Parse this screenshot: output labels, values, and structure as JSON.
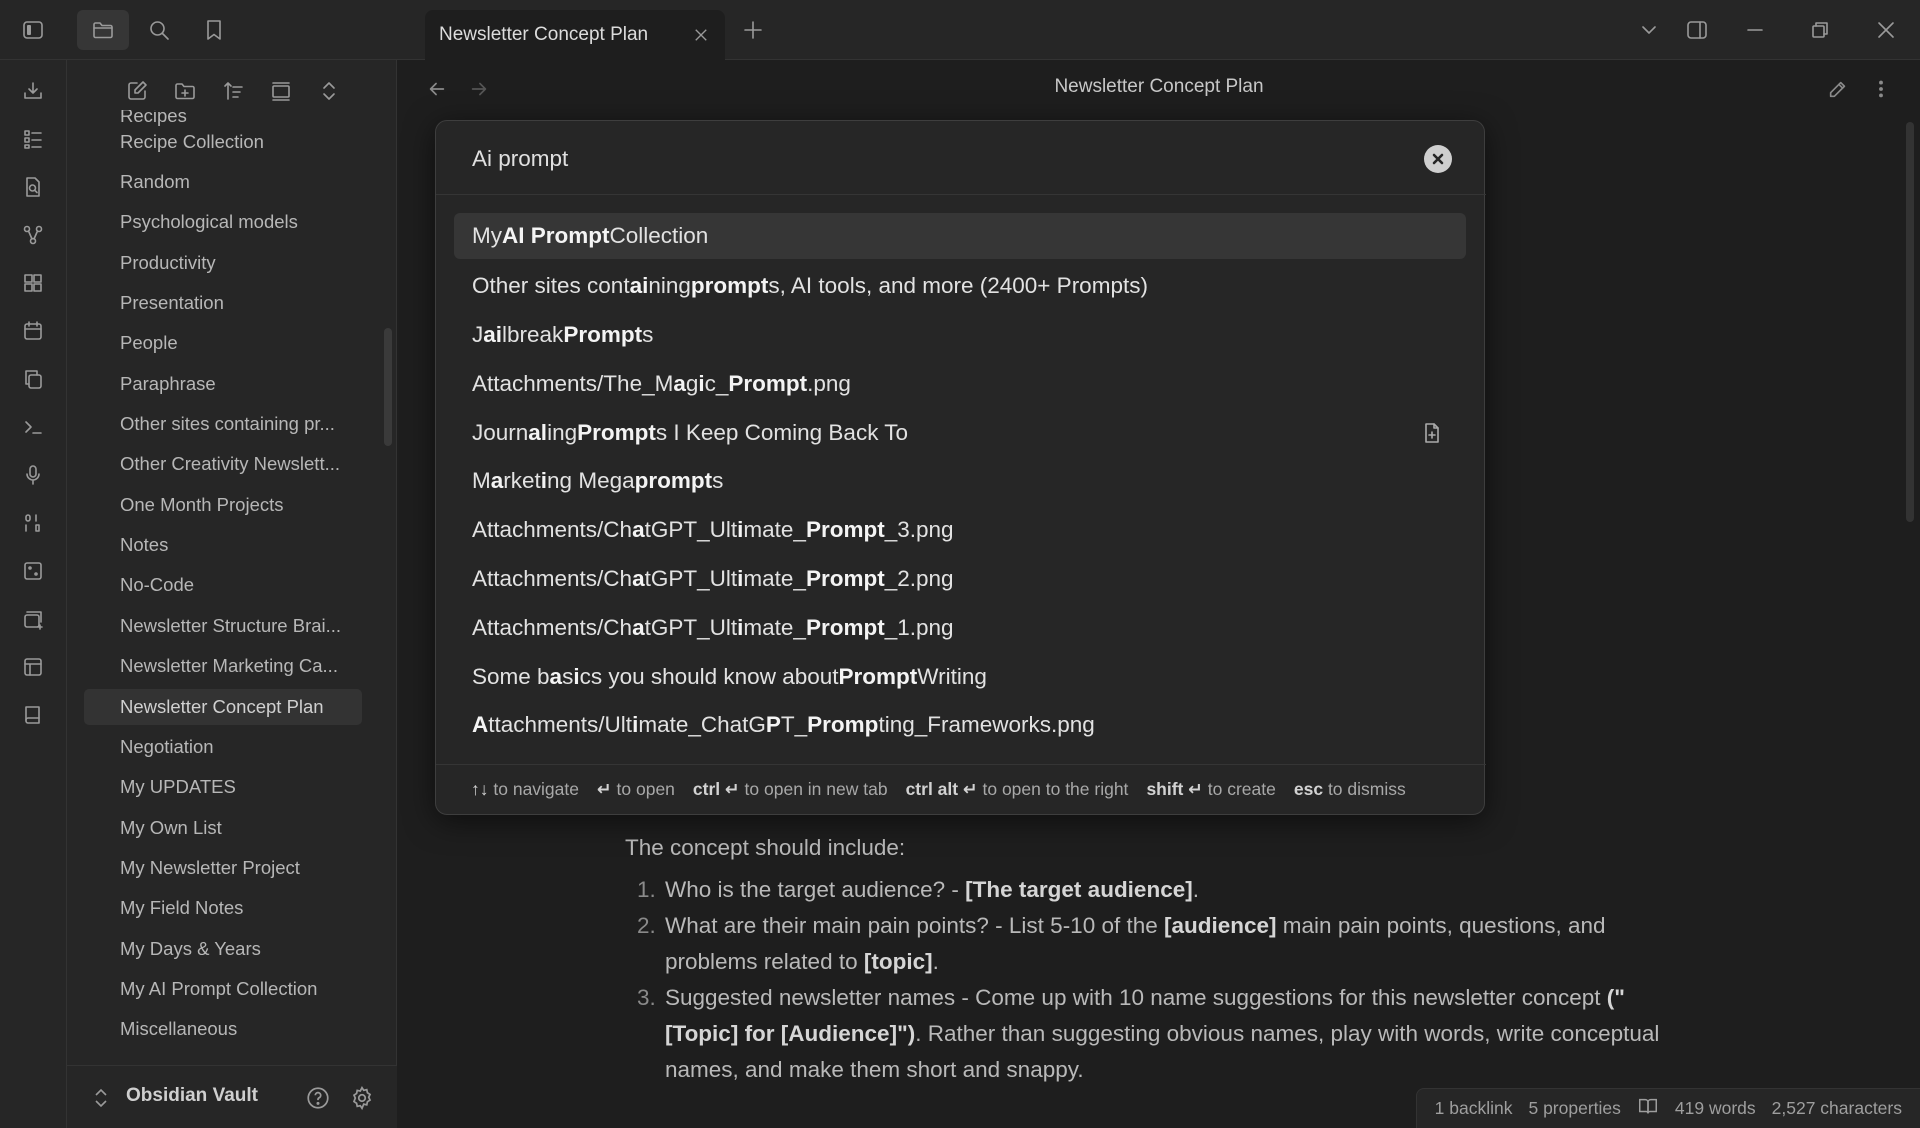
{
  "window": {
    "tab_title": "Newsletter Concept Plan"
  },
  "view": {
    "title": "Newsletter Concept Plan"
  },
  "sidebar": {
    "files": [
      "Recipes",
      "Recipe Collection",
      "Random",
      "Psychological models",
      "Productivity",
      "Presentation",
      "People",
      "Paraphrase",
      "Other sites containing pr...",
      "Other Creativity Newslett...",
      "One Month Projects",
      "Notes",
      "No-Code",
      "Newsletter Structure Brai...",
      "Newsletter Marketing Ca...",
      "Newsletter Concept Plan",
      "Negotiation",
      "My UPDATES",
      "My Own List",
      "My Newsletter  Project",
      "My Field Notes",
      "My Days & Years",
      "My AI Prompt Collection",
      "Miscellaneous"
    ],
    "active_file": "Newsletter Concept Plan",
    "vault_name": "Obsidian Vault"
  },
  "switcher": {
    "query": "Ai prompt",
    "results": [
      [
        [
          "My ",
          false
        ],
        [
          "AI Prompt",
          true
        ],
        [
          " Collection",
          false
        ]
      ],
      [
        [
          "Other sites cont",
          false
        ],
        [
          "ai",
          true
        ],
        [
          "ning ",
          false
        ],
        [
          "prompt",
          true
        ],
        [
          "s, AI tools, and more (2400+ Prompts)",
          false
        ]
      ],
      [
        [
          "J",
          false
        ],
        [
          "ai",
          true
        ],
        [
          "lbreak ",
          false
        ],
        [
          "Prompt",
          true
        ],
        [
          "s",
          false
        ]
      ],
      [
        [
          "Attachments/The_M",
          false
        ],
        [
          "a",
          true
        ],
        [
          "g",
          false
        ],
        [
          "i",
          true
        ],
        [
          "c_",
          false
        ],
        [
          "Prompt",
          true
        ],
        [
          ".png",
          false
        ]
      ],
      [
        [
          "Journ",
          false
        ],
        [
          "al",
          true
        ],
        [
          "i",
          false
        ],
        [
          "ng ",
          false
        ],
        [
          "Prompt",
          true
        ],
        [
          "s I Keep Coming Back To",
          false
        ]
      ],
      [
        [
          "M",
          false
        ],
        [
          "a",
          true
        ],
        [
          "rket",
          false
        ],
        [
          "i",
          true
        ],
        [
          "ng Mega ",
          false
        ],
        [
          "prompt",
          true
        ],
        [
          "s",
          false
        ]
      ],
      [
        [
          "Attachments/Ch",
          false
        ],
        [
          "a",
          true
        ],
        [
          "tGPT_Ult",
          false
        ],
        [
          "i",
          true
        ],
        [
          "mate_",
          false
        ],
        [
          "Prompt",
          true
        ],
        [
          "_3.png",
          false
        ]
      ],
      [
        [
          "Attachments/Ch",
          false
        ],
        [
          "a",
          true
        ],
        [
          "tGPT_Ult",
          false
        ],
        [
          "i",
          true
        ],
        [
          "mate_",
          false
        ],
        [
          "Prompt",
          true
        ],
        [
          "_2.png",
          false
        ]
      ],
      [
        [
          "Attachments/Ch",
          false
        ],
        [
          "a",
          true
        ],
        [
          "tGPT_Ult",
          false
        ],
        [
          "i",
          true
        ],
        [
          "mate_",
          false
        ],
        [
          "Prompt",
          true
        ],
        [
          "_1.png",
          false
        ]
      ],
      [
        [
          "Some b",
          false
        ],
        [
          "a",
          true
        ],
        [
          "s",
          false
        ],
        [
          "i",
          true
        ],
        [
          "cs you should know about ",
          false
        ],
        [
          "Prompt",
          true
        ],
        [
          " Writing",
          false
        ]
      ],
      [
        [
          "A",
          true
        ],
        [
          "ttachments/Ult",
          false
        ],
        [
          "i",
          true
        ],
        [
          "mate_ChatG",
          false
        ],
        [
          "P",
          true
        ],
        [
          "T_",
          false
        ],
        [
          "Promp",
          true
        ],
        [
          "ting_Frameworks.png",
          false
        ]
      ]
    ],
    "create_icon_row": 4,
    "hints": [
      {
        "key": "↑↓",
        "text": "to navigate"
      },
      {
        "key": "↵",
        "text": "to open"
      },
      {
        "key": "ctrl ↵",
        "text": "to open in new tab"
      },
      {
        "key": "ctrl alt ↵",
        "text": "to open to the right"
      },
      {
        "key": "shift ↵",
        "text": "to create"
      },
      {
        "key": "esc",
        "text": "to dismiss"
      }
    ]
  },
  "document": {
    "intro": "The concept should include:",
    "items": [
      {
        "num": "1.",
        "parts": [
          [
            "Who is the target audience? - ",
            false
          ],
          [
            "[The target audience]",
            true
          ],
          [
            ".",
            false
          ]
        ]
      },
      {
        "num": "2.",
        "parts": [
          [
            "What are their main pain points? - List 5-10 of the ",
            false
          ],
          [
            "[audience]",
            true
          ],
          [
            " main pain points, questions, and problems related to ",
            false
          ],
          [
            "[topic]",
            true
          ],
          [
            ".",
            false
          ]
        ]
      },
      {
        "num": "3.",
        "parts": [
          [
            "Suggested newsletter names - Come up with 10 name suggestions for this newsletter concept ",
            false
          ],
          [
            "(\"[Topic] for [Audience]\")",
            true
          ],
          [
            ". Rather than suggesting obvious names, play with words, write conceptual names, and make them short and snappy.",
            false
          ]
        ]
      }
    ]
  },
  "status": {
    "backlinks": "1 backlink",
    "properties": "5 properties",
    "words": "419 words",
    "characters": "2,527 characters"
  }
}
